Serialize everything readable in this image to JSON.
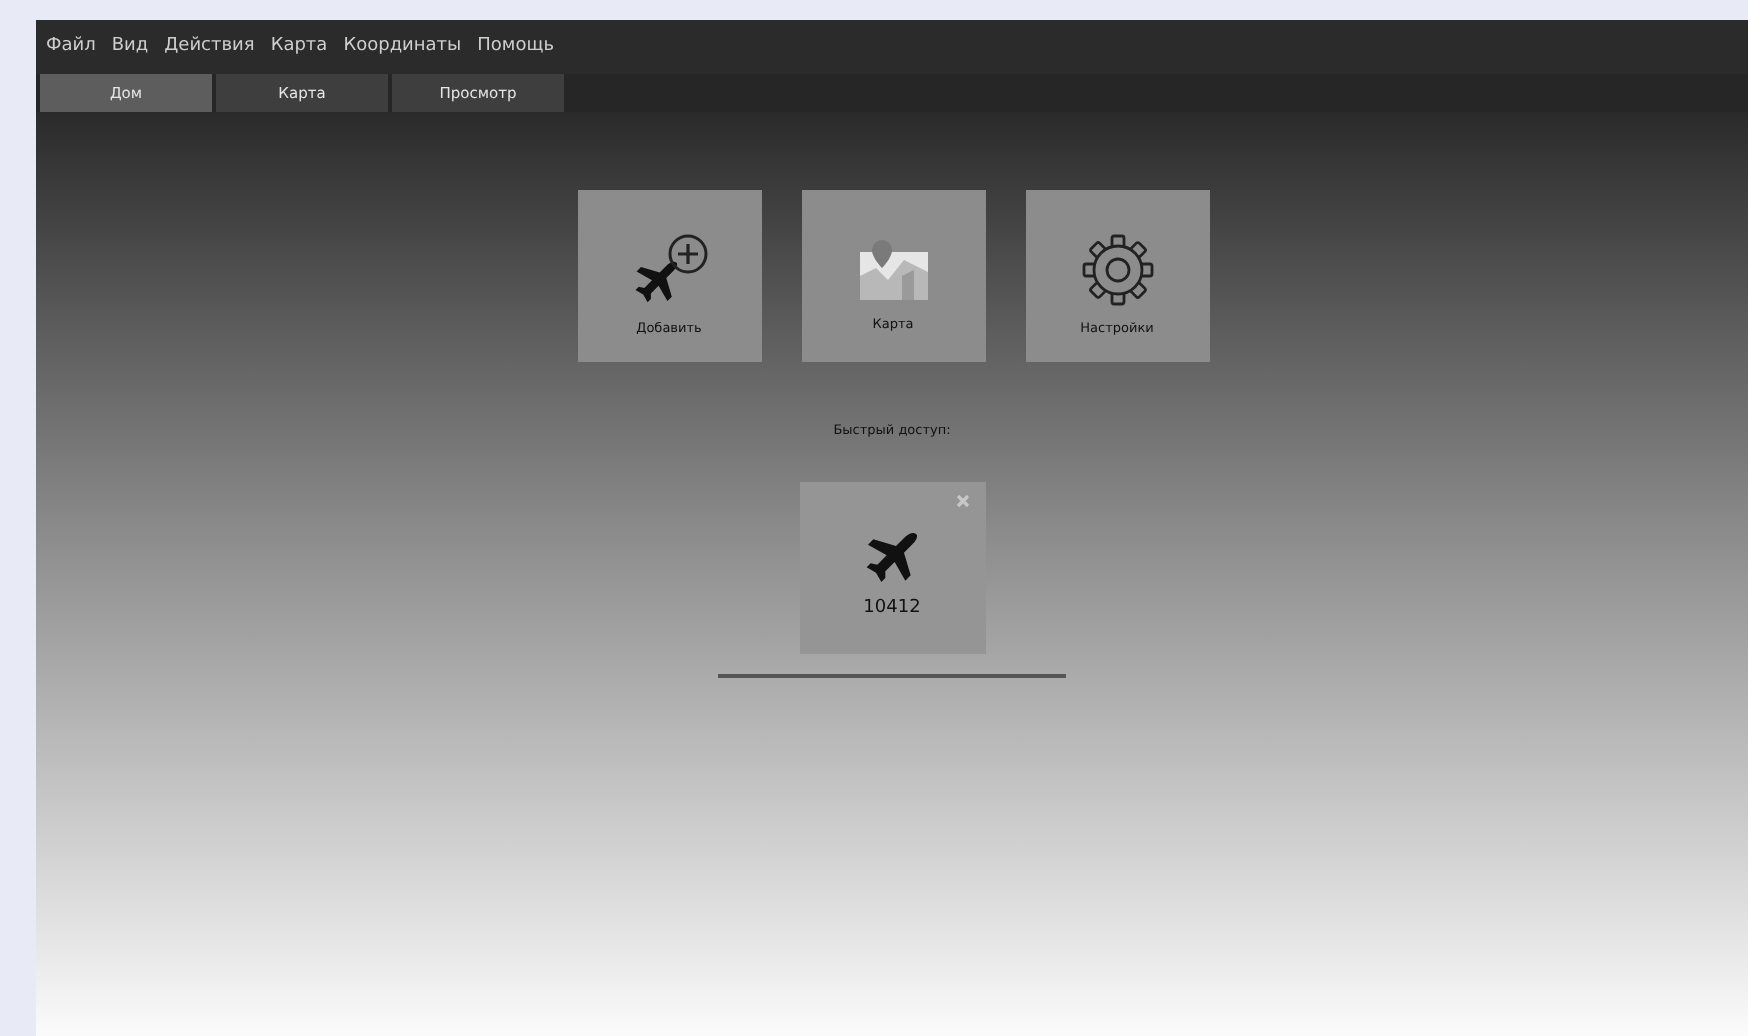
{
  "menu": [
    "Файл",
    "Вид",
    "Действия",
    "Карта",
    "Координаты",
    "Помощь"
  ],
  "tabs": [
    {
      "label": "Дом",
      "selected": true
    },
    {
      "label": "Карта",
      "selected": false
    },
    {
      "label": "Просмотр",
      "selected": false
    }
  ],
  "tiles": [
    {
      "kind": "add",
      "label": "Добавить"
    },
    {
      "kind": "map",
      "label": "Карта"
    },
    {
      "kind": "settings",
      "label": "Настройки"
    }
  ],
  "quick_access": {
    "title": "Быстрый доступ:",
    "items": [
      {
        "label": "10412"
      }
    ]
  }
}
